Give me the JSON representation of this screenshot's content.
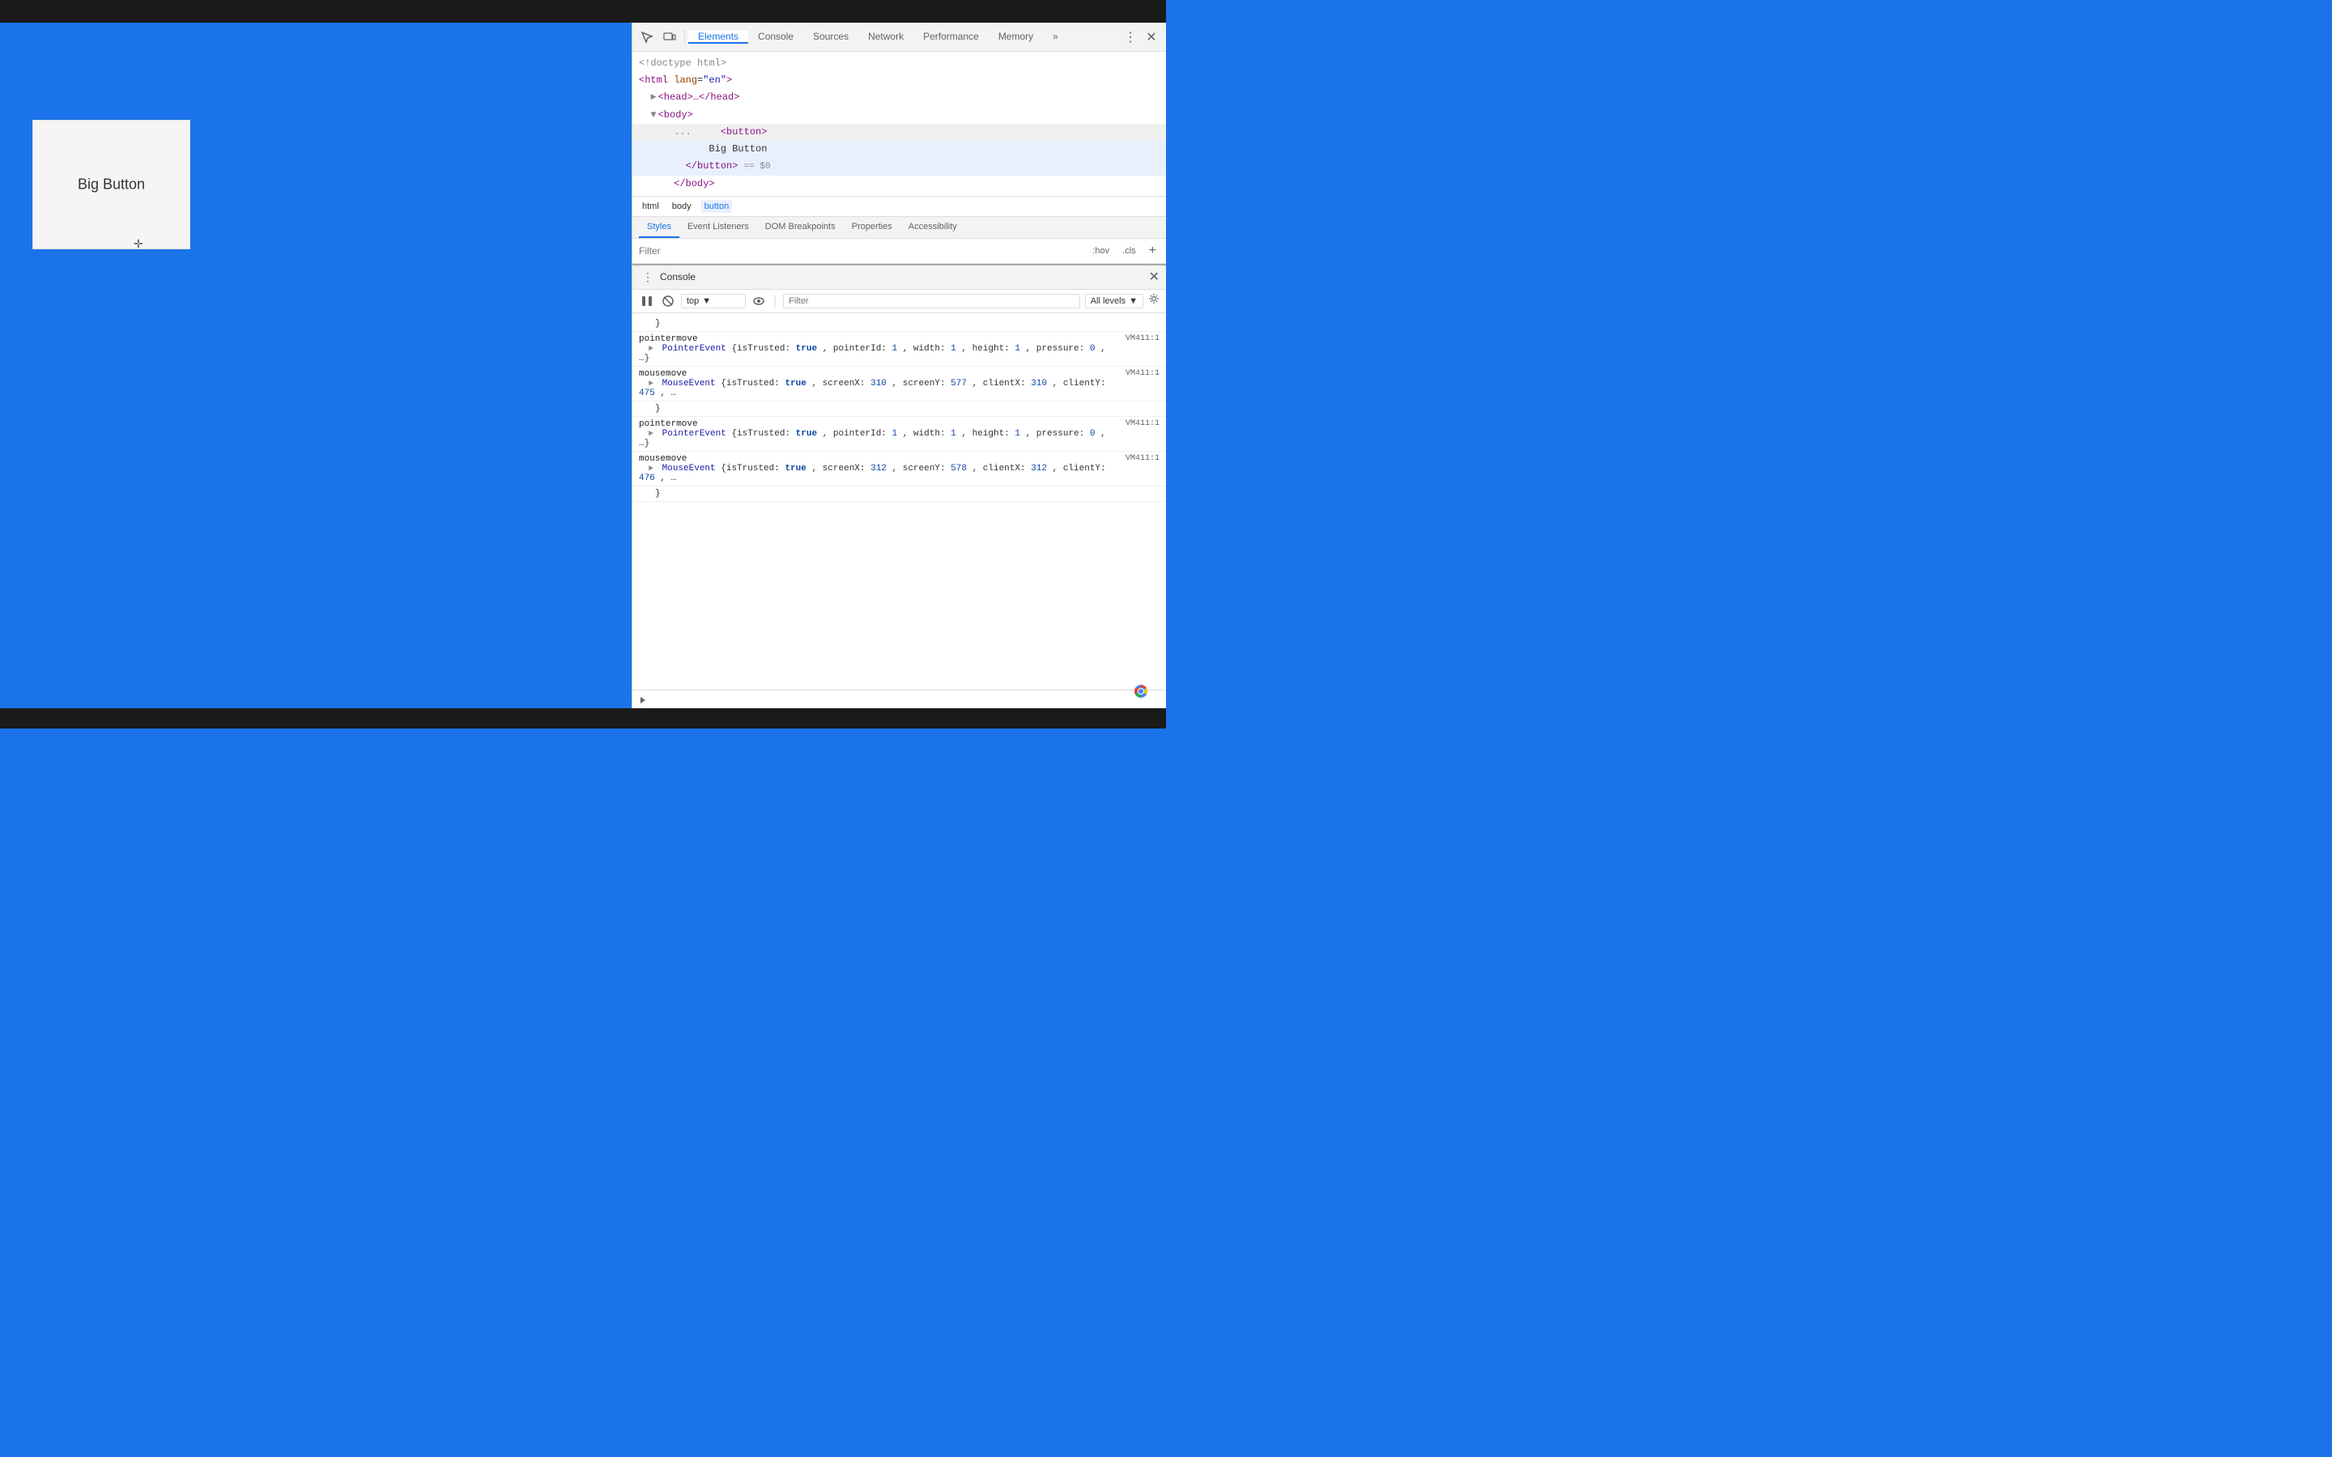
{
  "browser": {
    "top_bar": "",
    "bottom_bar": ""
  },
  "webpage": {
    "big_button_text": "Big Button"
  },
  "devtools": {
    "toolbar": {
      "inspect_icon": "⬚",
      "device_icon": "⬛",
      "tabs": [
        {
          "id": "elements",
          "label": "Elements",
          "active": true
        },
        {
          "id": "console",
          "label": "Console",
          "active": false
        },
        {
          "id": "sources",
          "label": "Sources",
          "active": false
        },
        {
          "id": "network",
          "label": "Network",
          "active": false
        },
        {
          "id": "performance",
          "label": "Performance",
          "active": false
        },
        {
          "id": "memory",
          "label": "Memory",
          "active": false
        }
      ],
      "more_icon": "»",
      "menu_icon": "⋮",
      "close_icon": "✕"
    },
    "elements": {
      "html_lines": [
        {
          "indent": 0,
          "content": "<!doctype html>",
          "type": "doctype"
        },
        {
          "indent": 0,
          "content": "<html lang=\"en\">",
          "type": "tag"
        },
        {
          "indent": 1,
          "content": "►<head>…</head>",
          "type": "collapsed"
        },
        {
          "indent": 1,
          "content": "▼<body>",
          "type": "expanded"
        },
        {
          "indent": 2,
          "content": "...",
          "type": "dots"
        },
        {
          "indent": 3,
          "content": "<button>",
          "type": "tag"
        },
        {
          "indent": 4,
          "content": "Big Button",
          "type": "text"
        },
        {
          "indent": 3,
          "content": "</button> == $0",
          "type": "closing"
        },
        {
          "indent": 2,
          "content": "</body>",
          "type": "tag"
        }
      ]
    },
    "breadcrumb": {
      "items": [
        {
          "label": "html",
          "active": false
        },
        {
          "label": "body",
          "active": false
        },
        {
          "label": "button",
          "active": true
        }
      ]
    },
    "styles_tabs": [
      {
        "label": "Styles",
        "active": true
      },
      {
        "label": "Event Listeners",
        "active": false
      },
      {
        "label": "DOM Breakpoints",
        "active": false
      },
      {
        "label": "Properties",
        "active": false
      },
      {
        "label": "Accessibility",
        "active": false
      }
    ],
    "filter": {
      "placeholder": "Filter",
      "hov_btn": ":hov",
      "cls_btn": ".cls",
      "add_btn": "+"
    },
    "console": {
      "title": "Console",
      "close_icon": "✕",
      "toolbar": {
        "play_icon": "▶",
        "ban_icon": "⊘",
        "context": "top",
        "eye_icon": "◎",
        "filter_placeholder": "Filter",
        "levels": "All levels",
        "settings_icon": "⚙"
      },
      "lines": [
        {
          "type": "brace",
          "content": "    }",
          "source": ""
        },
        {
          "type": "event",
          "name": "pointermove",
          "source": "VM411:1",
          "detail": "PointerEvent {isTrusted: true, pointerId: 1, width: 1, height: 1, pressure: 0, …}"
        },
        {
          "type": "event",
          "name": "mousemove",
          "source": "VM411:1",
          "detail": "MouseEvent {isTrusted: true, screenX: 310, screenY: 577, clientX: 310, clientY: 475, …",
          "has_child": true
        },
        {
          "type": "brace_child",
          "content": "    }",
          "source": ""
        },
        {
          "type": "event",
          "name": "pointermove",
          "source": "VM411:1",
          "detail": "PointerEvent {isTrusted: true, pointerId: 1, width: 1, height: 1, pressure: 0, …}"
        },
        {
          "type": "event",
          "name": "mousemove",
          "source": "VM411:1",
          "detail": "MouseEvent {isTrusted: true, screenX: 312, screenY: 578, clientX: 312, clientY: 476, …",
          "has_child": true
        },
        {
          "type": "brace_child2",
          "content": "    }",
          "source": ""
        }
      ]
    }
  }
}
